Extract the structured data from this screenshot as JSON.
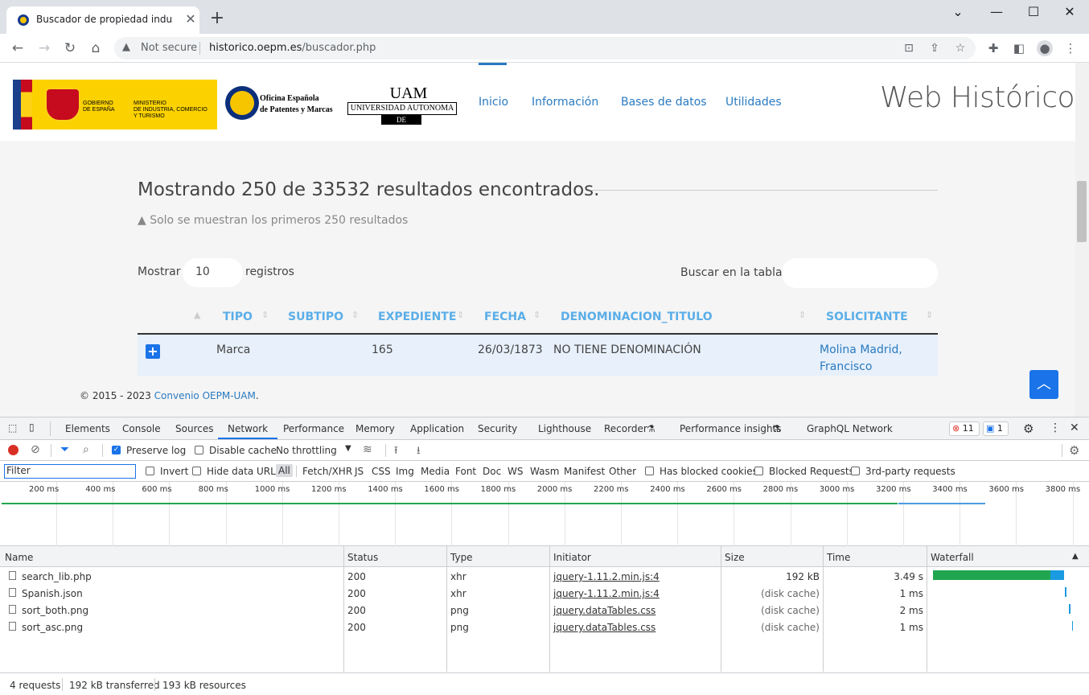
{
  "browser": {
    "tab_title": "Buscador de propiedad industrial",
    "tab_close": "✕",
    "new_tab": "+",
    "window_controls": {
      "minimize": "⌄",
      "min2": "—",
      "maximize": "☐",
      "close": "✕"
    },
    "security_label": "Not secure",
    "url_host": "historico.oepm.es",
    "url_path": "/buscador.php"
  },
  "header": {
    "gob_text_1": "GOBIERNO\nDE ESPAÑA",
    "gob_text_2": "MINISTERIO\nDE INDUSTRIA, COMERCIO\nY TURISMO",
    "oepm_text": "Oficina Española\nde Patentes y Marcas",
    "uam_mark": "UAM",
    "uam_name": "UNIVERSIDAD AUTONOMA",
    "uam_city": "DE MADRID",
    "nav": [
      "Inicio",
      "Información",
      "Bases de datos",
      "Utilidades"
    ],
    "site_title": "Web Histórico"
  },
  "results": {
    "title": "Mostrando 250 de 33532 resultados encontrados.",
    "note": "Solo se muestran los primeros 250 resultados",
    "mostrar_label": "Mostrar",
    "page_size": "10",
    "registros_label": "registros",
    "search_label": "Buscar en la tabla:",
    "columns": [
      "TIPO",
      "SUBTIPO",
      "EXPEDIENTE",
      "FECHA",
      "DENOMINACION_TITULO",
      "SOLICITANTE"
    ],
    "rows": [
      {
        "tipo": "Marca",
        "subtipo": "",
        "expediente": "165",
        "fecha": "26/03/1873",
        "denominacion": "NO TIENE DENOMINACIÓN",
        "solicitante_1": "Molina Madrid,",
        "solicitante_2": "Francisco"
      }
    ]
  },
  "footer": {
    "prefix": "© 2015 - 2023 ",
    "link": "Convenio OEPM-UAM",
    "suffix": "."
  },
  "devtools": {
    "tabs": [
      "Elements",
      "Console",
      "Sources",
      "Network",
      "Performance",
      "Memory",
      "Application",
      "Security",
      "Lighthouse",
      "Recorder",
      "Performance insights",
      "GraphQL Network"
    ],
    "errors": "11",
    "messages": "1",
    "preserve_log": "Preserve log",
    "disable_cache": "Disable cache",
    "throttling": "No throttling",
    "filter_placeholder": "Filter",
    "filter_opts": [
      "Invert",
      "Hide data URLs"
    ],
    "type_filters": [
      "All",
      "Fetch/XHR",
      "JS",
      "CSS",
      "Img",
      "Media",
      "Font",
      "Doc",
      "WS",
      "Wasm",
      "Manifest",
      "Other"
    ],
    "extra_filters": [
      "Has blocked cookies",
      "Blocked Requests",
      "3rd-party requests"
    ],
    "ticks": [
      "200 ms",
      "400 ms",
      "600 ms",
      "800 ms",
      "1000 ms",
      "1200 ms",
      "1400 ms",
      "1600 ms",
      "1800 ms",
      "2000 ms",
      "2200 ms",
      "2400 ms",
      "2600 ms",
      "2800 ms",
      "3000 ms",
      "3200 ms",
      "3400 ms",
      "3600 ms",
      "3800 ms"
    ],
    "columns": [
      "Name",
      "Status",
      "Type",
      "Initiator",
      "Size",
      "Time",
      "Waterfall"
    ],
    "requests": [
      {
        "name": "search_lib.php",
        "status": "200",
        "type": "xhr",
        "initiator": "jquery-1.11.2.min.js:4",
        "size": "192 kB",
        "time": "3.49 s"
      },
      {
        "name": "Spanish.json",
        "status": "200",
        "type": "xhr",
        "initiator": "jquery-1.11.2.min.js:4",
        "size": "(disk cache)",
        "time": "1 ms"
      },
      {
        "name": "sort_both.png",
        "status": "200",
        "type": "png",
        "initiator": "jquery.dataTables.css",
        "size": "(disk cache)",
        "time": "2 ms"
      },
      {
        "name": "sort_asc.png",
        "status": "200",
        "type": "png",
        "initiator": "jquery.dataTables.css",
        "size": "(disk cache)",
        "time": "1 ms"
      }
    ],
    "status_requests": "4 requests",
    "status_transferred": "192 kB transferred",
    "status_resources": "193 kB resources",
    "colors": {
      "accent": "#1a73e8",
      "green": "#21a650",
      "blue": "#4b9de0"
    }
  }
}
